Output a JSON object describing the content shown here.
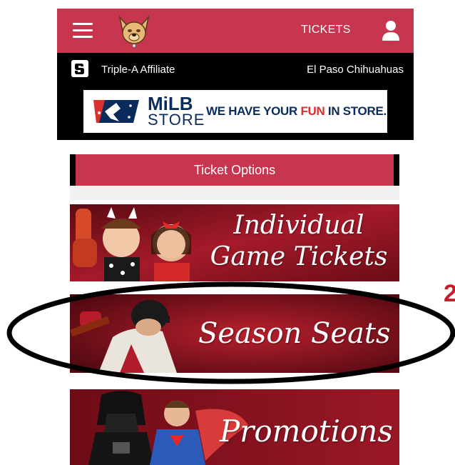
{
  "header": {
    "tickets_label": "TICKETS",
    "logo_icon": "chihuahua-logo",
    "menu_icon": "hamburger-icon",
    "user_icon": "user-icon",
    "background": "#c7354e"
  },
  "affiliate": {
    "left_text": "Triple-A Affiliate",
    "right_text": "El Paso Chihuahuas",
    "team_icon": "padres-icon"
  },
  "milb_ad": {
    "brand": "MiLB",
    "store": "STORE",
    "slogan_pre": "WE HAVE YOUR ",
    "slogan_fun": "FUN",
    "slogan_post": " IN STORE."
  },
  "ticket_options": {
    "label": "Ticket Options"
  },
  "banners": [
    {
      "title_line1": "Individual",
      "title_line2": "Game Tickets"
    },
    {
      "title": "Season Seats"
    },
    {
      "title": "Promotions"
    }
  ],
  "annotation": {
    "step_number": "2"
  }
}
